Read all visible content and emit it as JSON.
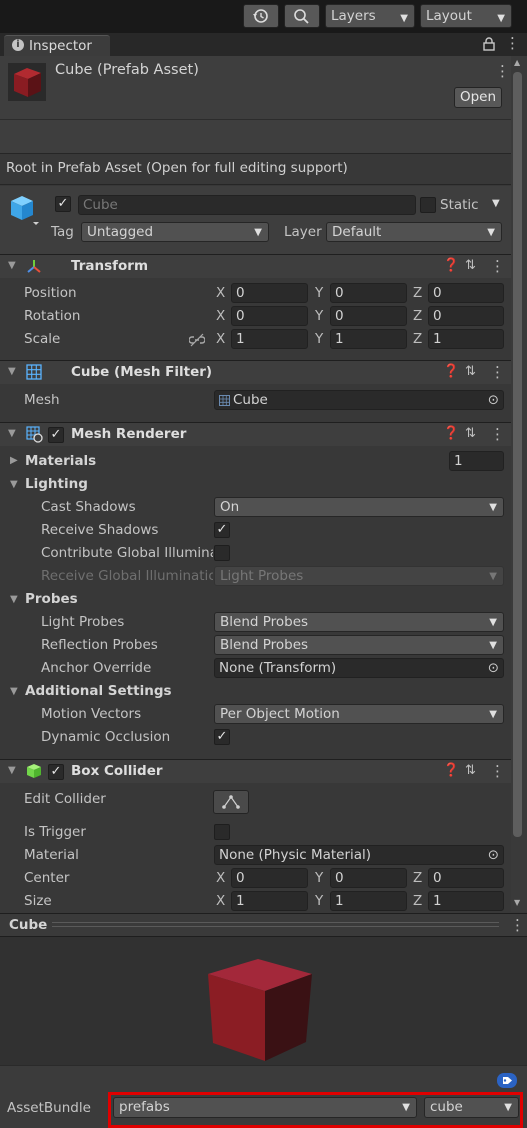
{
  "toolbar": {
    "history_icon": "history-icon",
    "search_icon": "search-icon",
    "layers": "Layers",
    "layout": "Layout"
  },
  "tab": {
    "info": "i",
    "label": "Inspector"
  },
  "asset": {
    "title": "Cube (Prefab Asset)",
    "open": "Open"
  },
  "notice": "Root in Prefab Asset (Open for full editing support)",
  "object": {
    "name": "Cube",
    "static_label": "Static",
    "tag_label": "Tag",
    "tag": "Untagged",
    "layer_label": "Layer",
    "layer": "Default"
  },
  "transform": {
    "title": "Transform",
    "rows": [
      {
        "label": "Position",
        "x": "0",
        "y": "0",
        "z": "0"
      },
      {
        "label": "Rotation",
        "x": "0",
        "y": "0",
        "z": "0"
      },
      {
        "label": "Scale",
        "x": "1",
        "y": "1",
        "z": "1"
      }
    ]
  },
  "axes": {
    "x": "X",
    "y": "Y",
    "z": "Z"
  },
  "mesh_filter": {
    "title": "Cube (Mesh Filter)",
    "mesh_label": "Mesh",
    "mesh": "Cube"
  },
  "mesh_renderer": {
    "title": "Mesh Renderer",
    "materials_label": "Materials",
    "materials_count": "1",
    "lighting": "Lighting",
    "cast_shadows_label": "Cast Shadows",
    "cast_shadows": "On",
    "receive_shadows_label": "Receive Shadows",
    "contribute_gi_label": "Contribute Global Illuminat",
    "receive_gi_label": "Receive Global Illumination",
    "receive_gi": "Light Probes",
    "probes": "Probes",
    "light_probes_label": "Light Probes",
    "light_probes": "Blend Probes",
    "reflection_probes_label": "Reflection Probes",
    "reflection_probes": "Blend Probes",
    "anchor_label": "Anchor Override",
    "anchor": "None (Transform)",
    "additional": "Additional Settings",
    "motion_label": "Motion Vectors",
    "motion": "Per Object Motion",
    "occlusion_label": "Dynamic Occlusion"
  },
  "box_collider": {
    "title": "Box Collider",
    "edit_label": "Edit Collider",
    "trigger_label": "Is Trigger",
    "material_label": "Material",
    "material": "None (Physic Material)",
    "center_label": "Center",
    "center": {
      "x": "0",
      "y": "0",
      "z": "0"
    },
    "size_label": "Size",
    "size": {
      "x": "1",
      "y": "1",
      "z": "1"
    }
  },
  "preview": {
    "title": "Cube"
  },
  "assetbundle": {
    "label": "AssetBundle",
    "name": "prefabs",
    "variant": "cube"
  },
  "colors": {
    "highlight": "#e00000",
    "cube": "#8b1d24"
  }
}
